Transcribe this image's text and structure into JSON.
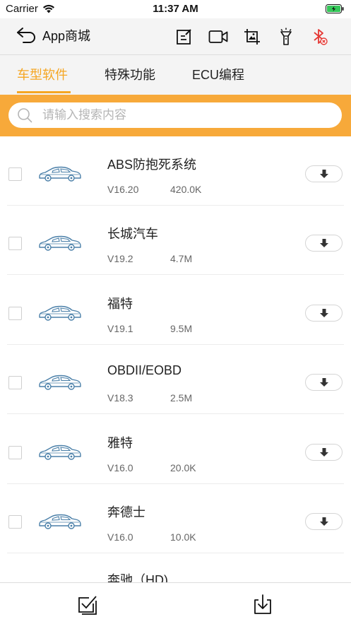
{
  "status_bar": {
    "carrier": "Carrier",
    "time": "11:37 AM"
  },
  "nav": {
    "title": "App商城"
  },
  "tabs": [
    {
      "label": "车型软件",
      "active": true
    },
    {
      "label": "特殊功能",
      "active": false
    },
    {
      "label": "ECU编程",
      "active": false
    }
  ],
  "search": {
    "placeholder": "请输入搜索内容"
  },
  "items": [
    {
      "name": "ABS防抱死系统",
      "version": "V16.20",
      "size": "420.0K"
    },
    {
      "name": "长城汽车",
      "version": "V19.2",
      "size": "4.7M"
    },
    {
      "name": "福特",
      "version": "V19.1",
      "size": "9.5M"
    },
    {
      "name": "OBDII/EOBD",
      "version": "V18.3",
      "size": "2.5M"
    },
    {
      "name": "雅特",
      "version": "V16.0",
      "size": "20.0K"
    },
    {
      "name": "奔德士",
      "version": "V16.0",
      "size": "10.0K"
    },
    {
      "name": "奔驰（HD)",
      "version": "",
      "size": ""
    }
  ],
  "colors": {
    "accent": "#f5a623",
    "search_bar": "#f7a93a",
    "car_icon": "#4a7fa8",
    "bluetooth_off": "#e53935"
  }
}
